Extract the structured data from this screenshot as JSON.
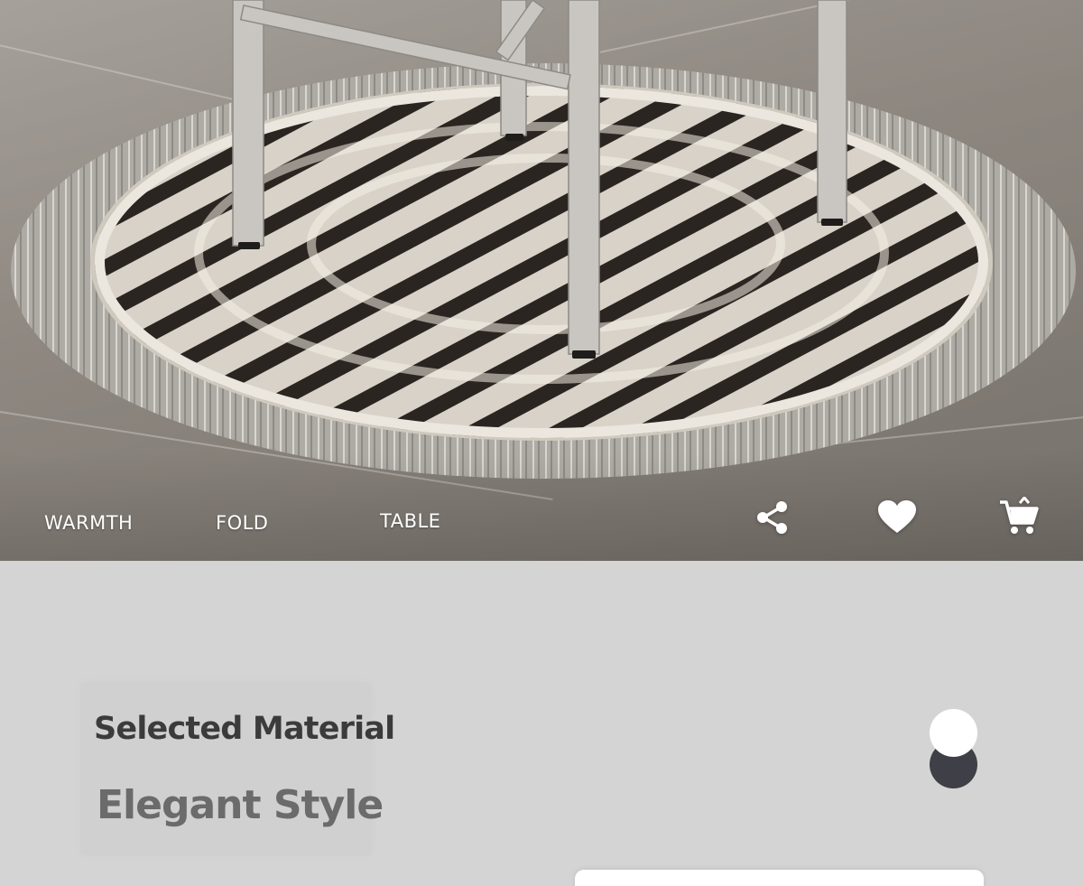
{
  "hero": {
    "tags": [
      "WARMTH",
      "FOLD",
      "TABLE"
    ]
  },
  "actions": {
    "share_icon": "share-icon",
    "favorite_icon": "heart-icon",
    "cart_icon": "cart-icon"
  },
  "info": {
    "title": "Selected Material",
    "subtitle": "Elegant Style"
  },
  "colors": {
    "background": "#d4d4d4",
    "title": "#3b3b3b",
    "subtitle": "#6b6b6b",
    "toggle_dark": "#3f3f47",
    "toggle_light": "#ffffff",
    "tag_text": "#ffffff"
  }
}
